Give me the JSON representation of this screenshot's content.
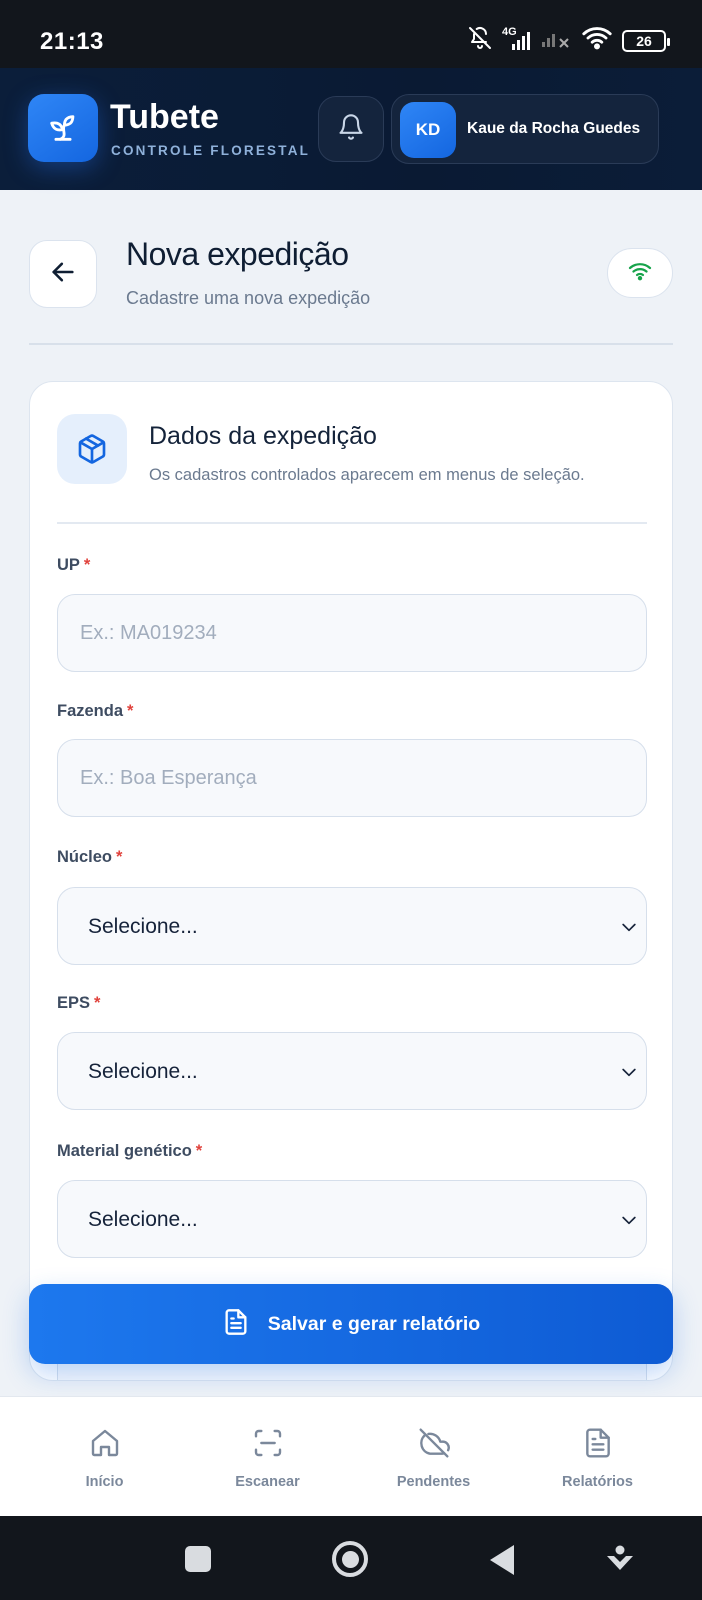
{
  "status_bar": {
    "time": "21:13",
    "network": "4G",
    "battery": "26",
    "icons": [
      "bell-off-icon",
      "signal-icon",
      "signal-x-icon",
      "wifi-icon",
      "battery-icon"
    ]
  },
  "app_header": {
    "brand_title": "Tubete",
    "brand_subtitle": "CONTROLE FLORESTAL",
    "logo_icon": "sprout-icon",
    "notification_icon": "bell-icon",
    "user": {
      "initials": "KD",
      "name": "Kaue da Rocha Guedes"
    }
  },
  "page": {
    "title": "Nova expedição",
    "subtitle": "Cadastre uma nova expedição",
    "back_icon": "arrow-left-icon",
    "connection_icon": "wifi-icon",
    "connection_color": "#16a34a"
  },
  "form": {
    "icon": "package-icon",
    "title": "Dados da expedição",
    "subtitle": "Os cadastros controlados aparecem em menus de seleção.",
    "required_mark": "*",
    "fields": {
      "up": {
        "label": "UP",
        "placeholder": "Ex.: MA019234",
        "value": ""
      },
      "fazenda": {
        "label": "Fazenda",
        "placeholder": "Ex.: Boa Esperança",
        "value": ""
      },
      "nucleo": {
        "label": "Núcleo",
        "value": "Selecione..."
      },
      "eps": {
        "label": "EPS",
        "value": "Selecione..."
      },
      "material": {
        "label": "Material genético",
        "value": "Selecione..."
      }
    }
  },
  "save_button": {
    "label": "Salvar e gerar relatório",
    "icon": "file-text-icon"
  },
  "bottom_nav": {
    "items": [
      {
        "label": "Início",
        "icon": "home-icon"
      },
      {
        "label": "Escanear",
        "icon": "scan-icon"
      },
      {
        "label": "Pendentes",
        "icon": "cloud-off-icon"
      },
      {
        "label": "Relatórios",
        "icon": "file-text-icon"
      }
    ]
  },
  "colors": {
    "accent": "#1466e0",
    "header_bg": "#0b1e3a",
    "required": "#e0413b",
    "page_bg": "#eef2f7"
  }
}
